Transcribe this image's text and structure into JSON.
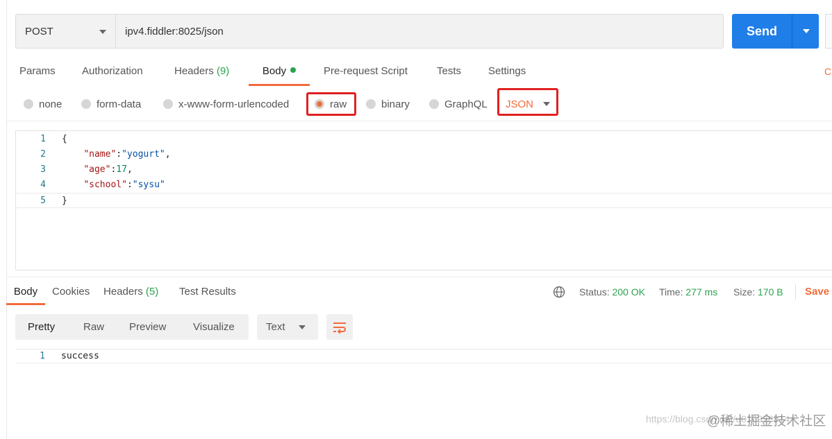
{
  "request": {
    "method": "POST",
    "url": "ipv4.fiddler:8025/json",
    "send_label": "Send"
  },
  "request_tabs": [
    {
      "label": "Params"
    },
    {
      "label": "Authorization"
    },
    {
      "label": "Headers",
      "count": "(9)"
    },
    {
      "label": "Body",
      "active": true,
      "indicator": "green-dot"
    },
    {
      "label": "Pre-request Script"
    },
    {
      "label": "Tests"
    },
    {
      "label": "Settings"
    }
  ],
  "tab_overflow_text": "C",
  "body_types": [
    {
      "label": "none"
    },
    {
      "label": "form-data"
    },
    {
      "label": "x-www-form-urlencoded"
    },
    {
      "label": "raw",
      "selected": true
    },
    {
      "label": "binary"
    },
    {
      "label": "GraphQL"
    }
  ],
  "raw_format": "JSON",
  "request_body_lines": [
    {
      "num": "1",
      "text": "{"
    },
    {
      "num": "2",
      "key": "\"name\"",
      "value": "\"yogurt\"",
      "suffix": ","
    },
    {
      "num": "3",
      "key": "\"age\"",
      "value": "17",
      "suffix": ","
    },
    {
      "num": "4",
      "key": "\"school\"",
      "value": "\"sysu\"",
      "suffix": ""
    },
    {
      "num": "5",
      "text": "}"
    }
  ],
  "response_tabs": [
    {
      "label": "Body",
      "active": true
    },
    {
      "label": "Cookies"
    },
    {
      "label": "Headers",
      "count": "(5)"
    },
    {
      "label": "Test Results"
    }
  ],
  "response_meta": {
    "status_label": "Status:",
    "status_value": "200 OK",
    "time_label": "Time:",
    "time_value": "277 ms",
    "size_label": "Size:",
    "size_value": "170 B",
    "save_label": "Save"
  },
  "response_views": [
    {
      "label": "Pretty",
      "active": true
    },
    {
      "label": "Raw"
    },
    {
      "label": "Preview"
    },
    {
      "label": "Visualize"
    }
  ],
  "response_format": "Text",
  "response_body_lines": [
    {
      "num": "1",
      "text": "success"
    }
  ],
  "watermark": {
    "url": "https://blog.csdn.net/u010978814",
    "site": "@稀土掘金技术社区"
  },
  "colors": {
    "accent": "#f26b3a",
    "send_blue": "#1f7ee8",
    "success_green": "#2aa44f",
    "highlight_red": "#e02020"
  }
}
